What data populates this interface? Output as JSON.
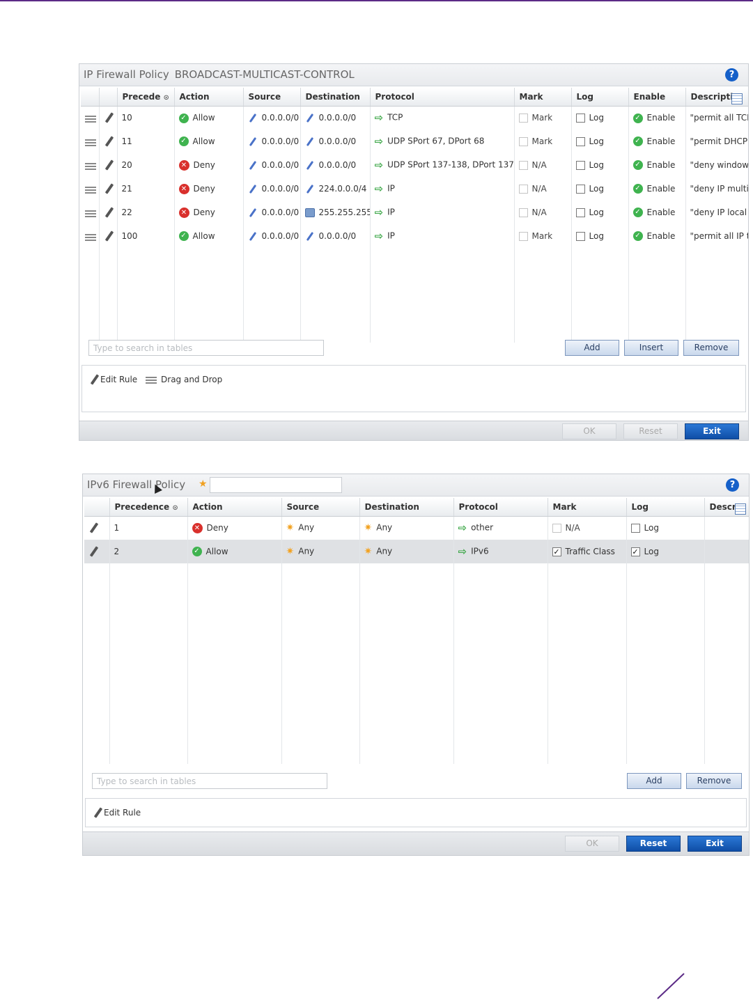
{
  "policy1": {
    "title": "IP Firewall Policy",
    "name": "BROADCAST-MULTICAST-CONTROL",
    "help": "?",
    "columns": [
      "Precede",
      "Action",
      "Source",
      "Destination",
      "Protocol",
      "Mark",
      "Log",
      "Enable",
      "Descriptio"
    ],
    "rows": [
      {
        "precedence": "10",
        "action": "Allow",
        "source": "0.0.0.0/0",
        "destination": "0.0.0.0/0",
        "protocol": "TCP",
        "mark": "Mark",
        "log": "Log",
        "enable": "Enable",
        "description": "\"permit all TCP"
      },
      {
        "precedence": "11",
        "action": "Allow",
        "source": "0.0.0.0/0",
        "destination": "0.0.0.0/0",
        "protocol": "UDP SPort 67, DPort 68",
        "mark": "Mark",
        "log": "Log",
        "enable": "Enable",
        "description": "\"permit DHCP r"
      },
      {
        "precedence": "20",
        "action": "Deny",
        "source": "0.0.0.0/0",
        "destination": "0.0.0.0/0",
        "protocol": "UDP SPort 137-138, DPort 137",
        "mark": "N/A",
        "log": "Log",
        "enable": "Enable",
        "description": "\"deny window"
      },
      {
        "precedence": "21",
        "action": "Deny",
        "source": "0.0.0.0/0",
        "destination": "224.0.0.0/4",
        "protocol": "IP",
        "mark": "N/A",
        "log": "Log",
        "enable": "Enable",
        "description": "\"deny IP multic"
      },
      {
        "precedence": "22",
        "action": "Deny",
        "source": "0.0.0.0/0",
        "destination": "255.255.255",
        "protocol": "IP",
        "mark": "N/A",
        "log": "Log",
        "enable": "Enable",
        "description": "\"deny IP local l"
      },
      {
        "precedence": "100",
        "action": "Allow",
        "source": "0.0.0.0/0",
        "destination": "0.0.0.0/0",
        "protocol": "IP",
        "mark": "Mark",
        "log": "Log",
        "enable": "Enable",
        "description": "\"permit all IP tr"
      }
    ],
    "search_placeholder": "Type to search in tables",
    "buttons": {
      "add": "Add",
      "insert": "Insert",
      "remove": "Remove"
    },
    "legend": {
      "edit": "Edit Rule",
      "drag": "Drag and Drop"
    },
    "footer": {
      "ok": "OK",
      "reset": "Reset",
      "exit": "Exit"
    }
  },
  "policy2": {
    "title": "IPv6 Firewall Policy",
    "help": "?",
    "columns": [
      "Precedence",
      "Action",
      "Source",
      "Destination",
      "Protocol",
      "Mark",
      "Log",
      "Descr"
    ],
    "rows": [
      {
        "precedence": "1",
        "action": "Deny",
        "source": "Any",
        "destination": "Any",
        "protocol": "other",
        "mark": "N/A",
        "mark_checked": false,
        "log": "Log",
        "log_checked": false
      },
      {
        "precedence": "2",
        "action": "Allow",
        "source": "Any",
        "destination": "Any",
        "protocol": "IPv6",
        "mark": "Traffic Class",
        "mark_checked": true,
        "log": "Log",
        "log_checked": true
      }
    ],
    "search_placeholder": "Type to search in tables",
    "buttons": {
      "add": "Add",
      "remove": "Remove"
    },
    "legend": {
      "edit": "Edit Rule"
    },
    "footer": {
      "ok": "OK",
      "reset": "Reset",
      "exit": "Exit"
    }
  },
  "colors": {
    "accent": "#5b2a86",
    "allow": "#3fb34f",
    "deny": "#d9302c",
    "primary_button": "#1a5fbf"
  },
  "icons": {
    "edit": "pencil-icon",
    "drag": "drag-handle-icon",
    "allow": "check-circle-icon",
    "deny": "x-circle-icon",
    "network": "network-alias-icon",
    "any": "any-star-icon",
    "protocol": "arrow-right-icon",
    "help": "help-icon",
    "columns": "column-picker-icon"
  }
}
